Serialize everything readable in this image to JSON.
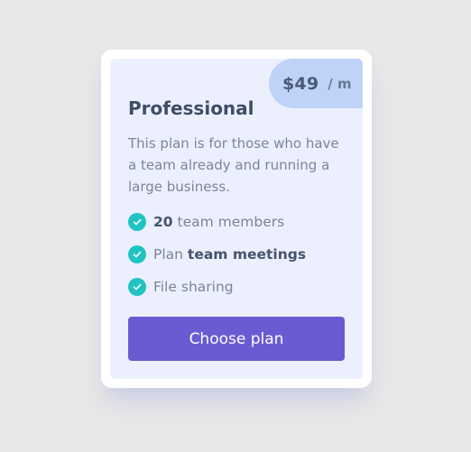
{
  "plan": {
    "price": "$49",
    "period": "/ m",
    "title": "Professional",
    "description": "This plan is for those who have a team already and running a large business.",
    "features": [
      {
        "strong": "20",
        "rest": " team members"
      },
      {
        "prefix": "Plan ",
        "strong": "team meetings"
      },
      {
        "text": "File sharing"
      }
    ],
    "button_label": "Choose plan"
  },
  "colors": {
    "background": "#e8e8e8",
    "card": "#ffffff",
    "card_inner": "#ecf0fe",
    "price_badge": "#bfd3f8",
    "check": "#21c3c2",
    "button": "#6b5bd2"
  },
  "icons": {
    "feature_check": "check-circle-icon"
  }
}
